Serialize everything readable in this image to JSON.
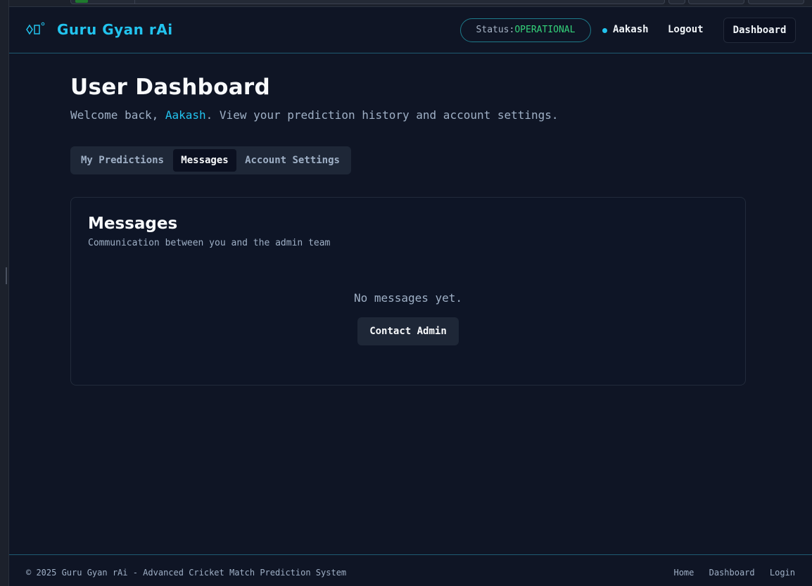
{
  "header": {
    "brand": "Guru Gyan rAi",
    "status_label": "Status:",
    "status_value": "OPERATIONAL",
    "user_name": "Aakash",
    "logout_label": "Logout",
    "dashboard_label": "Dashboard"
  },
  "main": {
    "title": "User Dashboard",
    "welcome_prefix": "Welcome back, ",
    "welcome_name": "Aakash",
    "welcome_suffix": ". View your prediction history and account settings.",
    "tabs": [
      {
        "label": "My Predictions",
        "active": false
      },
      {
        "label": "Messages",
        "active": true
      },
      {
        "label": "Account Settings",
        "active": false
      }
    ]
  },
  "messages_card": {
    "title": "Messages",
    "subtitle": "Communication between you and the admin team",
    "empty_text": "No messages yet.",
    "contact_button": "Contact Admin"
  },
  "footer": {
    "copyright": "© 2025 Guru Gyan rAi - Advanced Cricket Match Prediction System",
    "links": [
      "Home",
      "Dashboard",
      "Login"
    ]
  },
  "colors": {
    "background": "#0f1525",
    "accent": "#22c3ee",
    "status_ok": "#34d27a",
    "text_muted": "#9fb0c6"
  },
  "icons": {
    "logo": "diamond-rect-icon",
    "user_status": "online-dot-icon"
  }
}
